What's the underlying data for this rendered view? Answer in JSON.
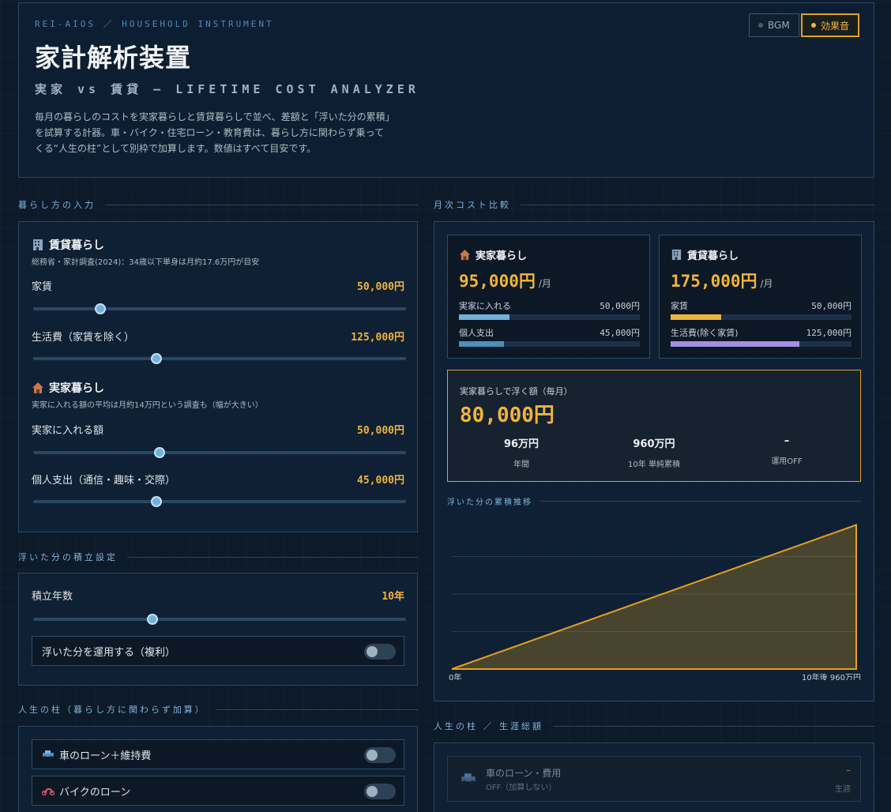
{
  "header": {
    "crumb": "REI-AIOS ／ HOUSEHOLD INSTRUMENT",
    "title": "家計解析装置",
    "subtitle": "実家 vs 賃貸 – LIFETIME COST ANALYZER",
    "description": "毎月の暮らしのコストを実家暮らしと賃貸暮らしで並べ、差額と「浮いた分の累積」を試算する計器。車・バイク・住宅ローン・教育費は、暮らし方に関わらず乗ってくる“人生の柱”として別枠で加算します。数値はすべて目安です。",
    "bgm_label": "BGM",
    "se_label": "効果音",
    "accent": "#f0b43a"
  },
  "inputs": {
    "section_label": "暮らし方の入力",
    "rent": {
      "icon": "building-icon",
      "title": "賃貸暮らし",
      "note": "総務省・家計調査(2024)：34歳以下単身は月約17.6万円が目安",
      "rows": [
        {
          "label": "家賃",
          "value": "50,000円",
          "level": 0.18
        },
        {
          "label": "生活費（家賃を除く）",
          "value": "125,000円",
          "level": 0.33
        }
      ]
    },
    "home": {
      "icon": "house-icon",
      "title": "実家暮らし",
      "note": "実家に入れる額の平均は月約14万円という調査も（幅が大きい）",
      "rows": [
        {
          "label": "実家に入れる額",
          "value": "50,000円",
          "level": 0.34
        },
        {
          "label": "個人支出（通信・趣味・交際）",
          "value": "45,000円",
          "level": 0.33
        }
      ]
    }
  },
  "savings_settings": {
    "section_label": "浮いた分の積立設定",
    "years_label": "積立年数",
    "years_value": "10年",
    "years_level": 0.32,
    "invest_label": "浮いた分を運用する（複利）",
    "invest_on": false
  },
  "pillars_input": {
    "section_label": "人生の柱（暮らし方に関わらず加算）",
    "items": [
      {
        "icon": "car-icon",
        "label": "車のローン＋維持費",
        "on": false
      },
      {
        "icon": "motorbike-icon",
        "label": "バイクのローン",
        "on": false
      }
    ]
  },
  "monthly": {
    "section_label": "月次コスト比較",
    "home_card": {
      "title": "実家暮らし",
      "amount": "95,000円",
      "per": "/月",
      "rows": [
        {
          "label": "実家に入れる",
          "value": "50,000円",
          "fraction": 0.28,
          "color": "#6fb2db"
        },
        {
          "label": "個人支出",
          "value": "45,000円",
          "fraction": 0.25,
          "color": "#4d8fb8"
        }
      ]
    },
    "rent_card": {
      "title": "賃貸暮らし",
      "amount": "175,000円",
      "per": "/月",
      "rows": [
        {
          "label": "家賃",
          "value": "50,000円",
          "fraction": 0.28,
          "color": "#f0b43a"
        },
        {
          "label": "生活費(除く家賃)",
          "value": "125,000円",
          "fraction": 0.71,
          "color": "#a58ee0"
        }
      ]
    },
    "saving": {
      "label": "実家暮らしで浮く額（毎月）",
      "amount": "80,000円",
      "stats": [
        {
          "value": "96万円",
          "label": "年間"
        },
        {
          "value": "960万円",
          "label": "10年 単純累積"
        },
        {
          "value": "–",
          "label": "運用OFF"
        }
      ]
    },
    "chart_label": "浮いた分の累積推移"
  },
  "chart_data": {
    "type": "area",
    "x": [
      0,
      10
    ],
    "values": [
      0,
      960
    ],
    "x_start_label": "0年",
    "x_end_label": "10年後 960万円",
    "ylim": [
      0,
      1000
    ],
    "grid": true,
    "color": "#e2a21f"
  },
  "lifetime": {
    "section_label": "人生の柱 ／ 生涯総額",
    "items": [
      {
        "icon": "car-icon",
        "title": "車のローン・費用",
        "status": "OFF（加算しない）",
        "value": "–",
        "unit": "生涯"
      }
    ]
  }
}
